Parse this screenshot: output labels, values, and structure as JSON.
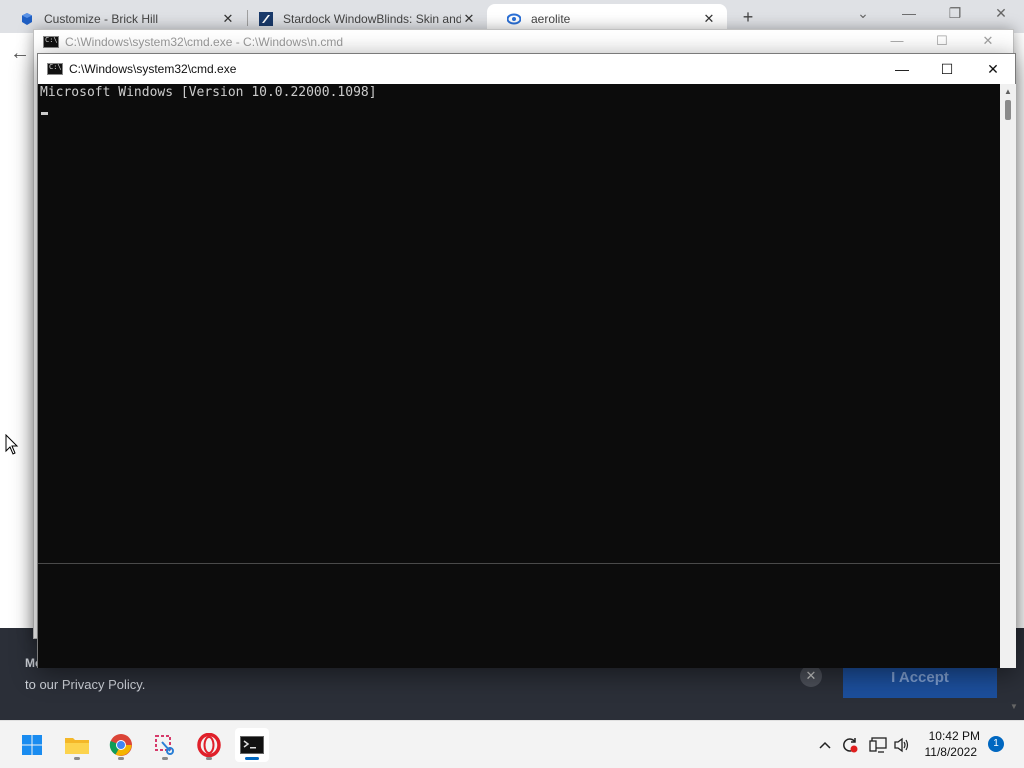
{
  "browser": {
    "tabs": [
      {
        "title": "Customize - Brick Hill",
        "favicon": "brick-hill-icon"
      },
      {
        "title": "Stardock WindowBlinds: Skin and",
        "favicon": "stardock-icon"
      },
      {
        "title": "aerolite",
        "favicon": "deviantart-icon"
      }
    ],
    "tab_close_glyph": "✕",
    "new_tab_glyph": "+",
    "back_glyph": "←",
    "cookie": {
      "text_a": "Mo",
      "text_b": "to our Privacy Policy.",
      "close_glyph": "✕",
      "accept_label": "I Accept"
    }
  },
  "back_window": {
    "title": "C:\\Windows\\system32\\cmd.exe - C:\\Windows\\n.cmd",
    "minimize": "—",
    "maximize": "☐",
    "close": "✕"
  },
  "front_window": {
    "title": "C:\\Windows\\system32\\cmd.exe",
    "minimize": "—",
    "maximize": "☐",
    "close": "✕",
    "console_text": "Microsoft Windows [Version 10.0.22000.1098]"
  },
  "taskbar": {
    "apps": [
      "start-icon",
      "file-explorer-icon",
      "chrome-icon",
      "snipping-tool-icon",
      "opera-icon",
      "terminal-icon"
    ],
    "tray_glyphs": {
      "chevron": "^",
      "volume": "🔊"
    },
    "time": "10:42 PM",
    "date": "11/8/2022",
    "notifications": "1"
  },
  "colors": {
    "console_bg": "#0c0c0c",
    "console_fg": "#cccccc",
    "accent": "#0067c0",
    "cookie_bar": "#2b2f38"
  }
}
